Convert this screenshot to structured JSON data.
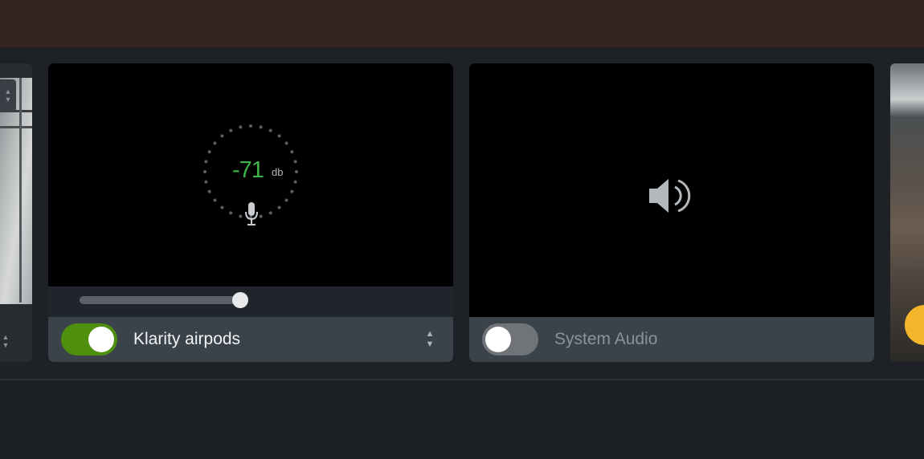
{
  "mic_card": {
    "level_value": "-71",
    "level_unit": "db",
    "volume_level": 0.99,
    "enabled": true,
    "device_label": "Klarity airpods"
  },
  "system_audio_card": {
    "enabled": false,
    "label": "System Audio"
  },
  "icons": {
    "mic": "microphone-icon",
    "speaker": "speaker-icon",
    "stepper": "up-down-stepper-icon"
  },
  "colors": {
    "level_text": "#3fb44a",
    "toggle_on": "#4e8f0e",
    "toggle_off": "#707478",
    "accent_right": "#f4b52a"
  }
}
